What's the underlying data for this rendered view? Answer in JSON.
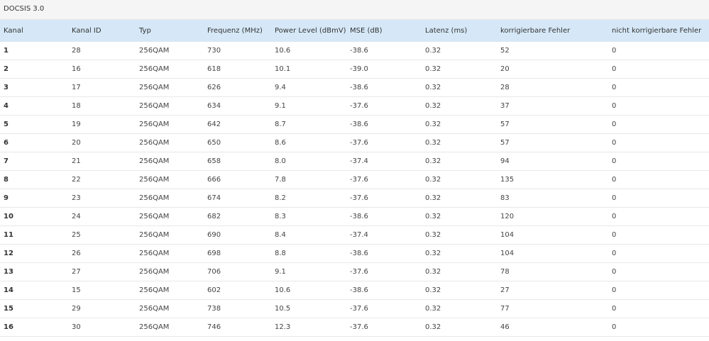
{
  "section": {
    "title": "DOCSIS 3.0"
  },
  "table": {
    "headers": [
      "Kanal",
      "Kanal ID",
      "Typ",
      "Frequenz (MHz)",
      "Power Level (dBmV)",
      "MSE (dB)",
      "Latenz (ms)",
      "korrigierbare Fehler",
      "nicht korrigierbare Fehler"
    ],
    "rows": [
      [
        "1",
        "28",
        "256QAM",
        "730",
        "10.6",
        "-38.6",
        "0.32",
        "52",
        "0"
      ],
      [
        "2",
        "16",
        "256QAM",
        "618",
        "10.1",
        "-39.0",
        "0.32",
        "20",
        "0"
      ],
      [
        "3",
        "17",
        "256QAM",
        "626",
        "9.4",
        "-38.6",
        "0.32",
        "28",
        "0"
      ],
      [
        "4",
        "18",
        "256QAM",
        "634",
        "9.1",
        "-37.6",
        "0.32",
        "37",
        "0"
      ],
      [
        "5",
        "19",
        "256QAM",
        "642",
        "8.7",
        "-38.6",
        "0.32",
        "57",
        "0"
      ],
      [
        "6",
        "20",
        "256QAM",
        "650",
        "8.6",
        "-37.6",
        "0.32",
        "57",
        "0"
      ],
      [
        "7",
        "21",
        "256QAM",
        "658",
        "8.0",
        "-37.4",
        "0.32",
        "94",
        "0"
      ],
      [
        "8",
        "22",
        "256QAM",
        "666",
        "7.8",
        "-37.6",
        "0.32",
        "135",
        "0"
      ],
      [
        "9",
        "23",
        "256QAM",
        "674",
        "8.2",
        "-37.6",
        "0.32",
        "83",
        "0"
      ],
      [
        "10",
        "24",
        "256QAM",
        "682",
        "8.3",
        "-38.6",
        "0.32",
        "120",
        "0"
      ],
      [
        "11",
        "25",
        "256QAM",
        "690",
        "8.4",
        "-37.4",
        "0.32",
        "104",
        "0"
      ],
      [
        "12",
        "26",
        "256QAM",
        "698",
        "8.8",
        "-38.6",
        "0.32",
        "104",
        "0"
      ],
      [
        "13",
        "27",
        "256QAM",
        "706",
        "9.1",
        "-37.6",
        "0.32",
        "78",
        "0"
      ],
      [
        "14",
        "15",
        "256QAM",
        "602",
        "10.6",
        "-38.6",
        "0.32",
        "27",
        "0"
      ],
      [
        "15",
        "29",
        "256QAM",
        "738",
        "10.5",
        "-37.6",
        "0.32",
        "77",
        "0"
      ],
      [
        "16",
        "30",
        "256QAM",
        "746",
        "12.3",
        "-37.6",
        "0.32",
        "46",
        "0"
      ]
    ]
  },
  "colors": {
    "header_bg": "#d6e8f7",
    "section_bg": "#f5f5f5"
  }
}
